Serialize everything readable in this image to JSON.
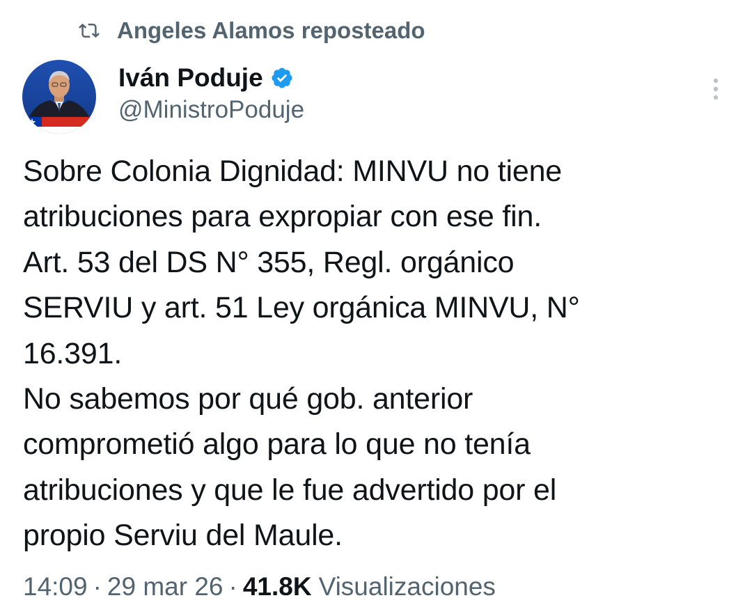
{
  "repost": {
    "icon": "repost-icon",
    "text": "Angeles Alamos reposteado"
  },
  "author": {
    "avatar": "avatar",
    "name": "Iván Poduje",
    "verified_icon": "verified-icon",
    "handle": "@MinistroPoduje"
  },
  "menu": {
    "icon": "more-vertical-icon"
  },
  "tweet": {
    "text": "Sobre Colonia Dignidad: MINVU no tiene\natribuciones para expropiar con ese fin.\nArt. 53 del DS N° 355, Regl. orgánico\nSERVIU y art. 51 Ley orgánica MINVU, N°\n16.391.\nNo sabemos por qué gob. anterior\ncomprometió algo para lo que no tenía\natribuciones y que le fue advertido por el\npropio Serviu del Maule."
  },
  "meta": {
    "time": "14:09",
    "separator": "·",
    "date": "29 mar 26",
    "views_count": "41.8K",
    "views_label": "Visualizaciones"
  },
  "colors": {
    "text_primary": "#0f1419",
    "text_secondary": "#536471",
    "verified_blue": "#1d9bf0",
    "background": "#ffffff"
  }
}
